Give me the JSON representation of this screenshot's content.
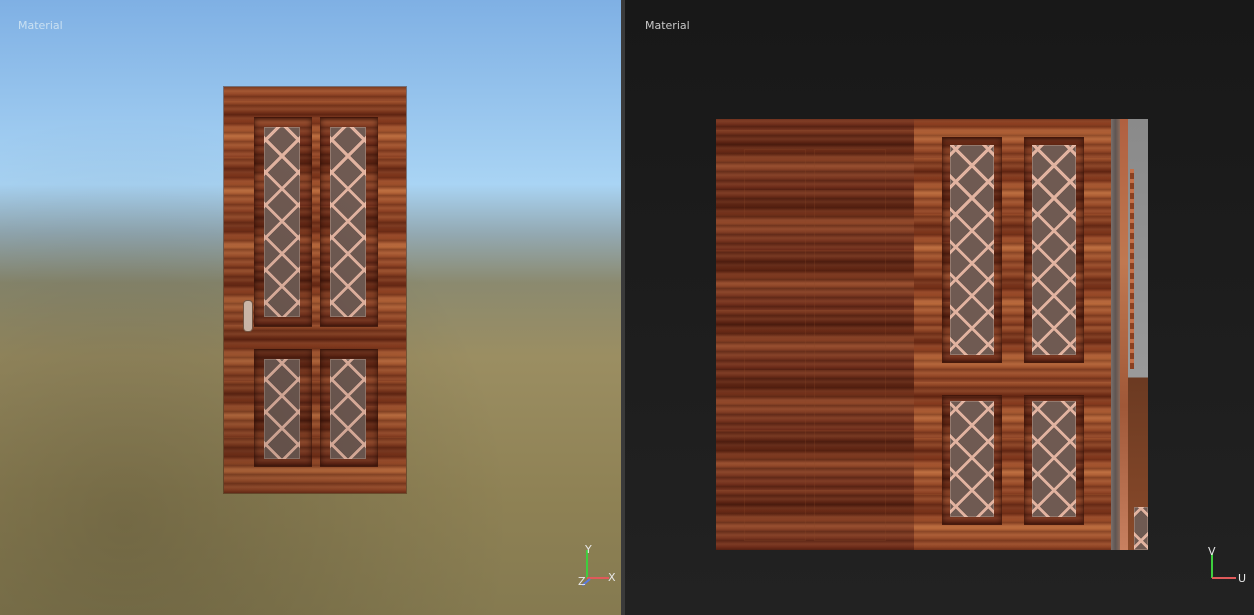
{
  "viewport_3d": {
    "title": "Material",
    "axes": {
      "y": "Y",
      "z": "Z",
      "x": "X"
    }
  },
  "viewport_uv": {
    "title": "Material",
    "axes": {
      "v": "V",
      "u": "U"
    }
  },
  "colors": {
    "axis_y": "#3ecf3e",
    "axis_x": "#e05a5a",
    "axis_z": "#5a7ae0",
    "lattice": "#e2b3a0"
  }
}
